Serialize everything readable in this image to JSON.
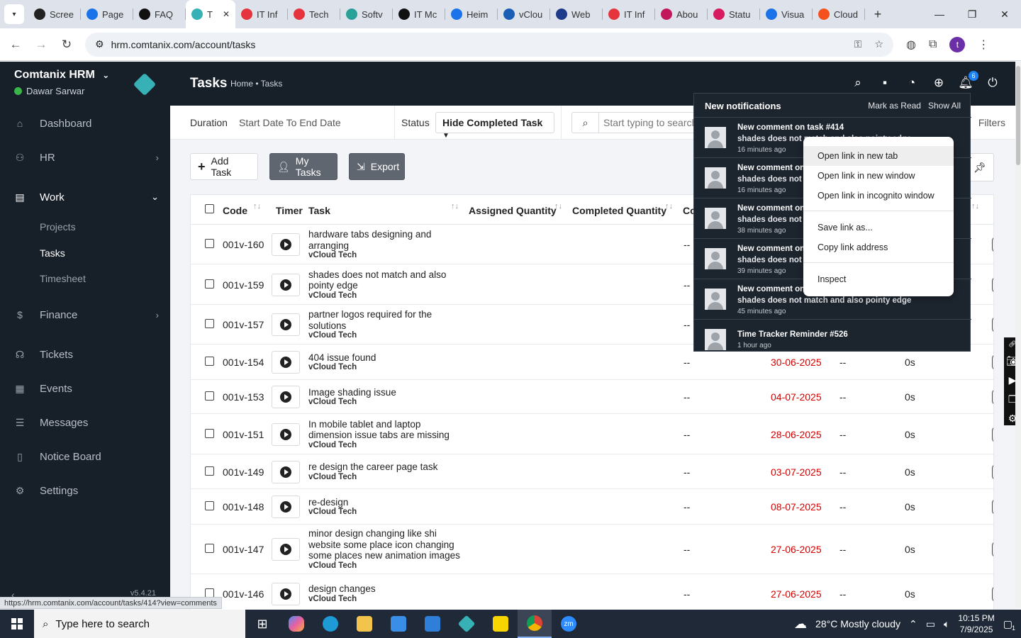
{
  "browser": {
    "tabs": [
      {
        "label": "Scree",
        "color": "#222222"
      },
      {
        "label": "Page",
        "color": "#1a73e8"
      },
      {
        "label": "FAQ",
        "color": "#111111"
      },
      {
        "label": "T",
        "color": "#38b1b6"
      },
      {
        "label": "IT Inf",
        "color": "#e5343e"
      },
      {
        "label": "Tech",
        "color": "#e5343e"
      },
      {
        "label": "Softv",
        "color": "#2aa198"
      },
      {
        "label": "IT Mc",
        "color": "#111111"
      },
      {
        "label": "Heim",
        "color": "#1a73e8"
      },
      {
        "label": "vClou",
        "color": "#1a5fb4"
      },
      {
        "label": "Web",
        "color": "#1e3a8a"
      },
      {
        "label": "IT Inf",
        "color": "#e5343e"
      },
      {
        "label": "Abou",
        "color": "#c2185b"
      },
      {
        "label": "Statu",
        "color": "#d81b60"
      },
      {
        "label": "Visua",
        "color": "#1a73e8"
      },
      {
        "label": "Cloud",
        "color": "#f4511e"
      }
    ],
    "url": "hrm.comtanix.com/account/tasks",
    "profile_initial": "t",
    "status_url": "https://hrm.comtanix.com/account/tasks/414?view=comments"
  },
  "sidebar": {
    "brand": "Comtanix HRM",
    "user": "Dawar Sarwar",
    "version": "v5.4.21",
    "items": [
      {
        "label": "Dashboard",
        "icon": "home-icon"
      },
      {
        "label": "HR",
        "icon": "users-icon"
      },
      {
        "label": "Work",
        "icon": "briefcase-icon"
      },
      {
        "label": "Finance",
        "icon": "dollar-icon"
      },
      {
        "label": "Tickets",
        "icon": "headset-icon"
      },
      {
        "label": "Events",
        "icon": "calendar-icon"
      },
      {
        "label": "Messages",
        "icon": "message-icon"
      },
      {
        "label": "Notice Board",
        "icon": "clipboard-icon"
      },
      {
        "label": "Settings",
        "icon": "gear-icon"
      }
    ],
    "work_sub": [
      "Projects",
      "Tasks",
      "Timesheet"
    ]
  },
  "header": {
    "title": "Tasks",
    "breadcrumb": "Home • Tasks",
    "notification_count": "6"
  },
  "filters": {
    "duration_label": "Duration",
    "duration_value": "Start Date To End Date",
    "status_label": "Status",
    "status_value": "Hide Completed Task",
    "search_placeholder": "Start typing to search",
    "filters_label": "Filters"
  },
  "actions": {
    "add_task": "Add Task",
    "my_tasks": "My Tasks",
    "export": "Export"
  },
  "table": {
    "columns": [
      "Code",
      "Timer",
      "Task",
      "Assigned Quantity",
      "Completed Quantity",
      "Co"
    ],
    "rows": [
      {
        "code": "001v-160",
        "title": "hardware tabs designing and arranging",
        "client": "vCloud Tech",
        "col1": "--",
        "due": "",
        "col3": "",
        "time": ""
      },
      {
        "code": "001v-159",
        "title": "shades does not match and also pointy edge",
        "client": "vCloud Tech",
        "col1": "--",
        "due": "",
        "col3": "",
        "time": ""
      },
      {
        "code": "001v-157",
        "title": "partner logos required for the solutions",
        "client": "vCloud Tech",
        "col1": "--",
        "due": "",
        "col3": "",
        "time": ""
      },
      {
        "code": "001v-154",
        "title": "404 issue found",
        "client": "vCloud Tech",
        "col1": "--",
        "due": "30-06-2025",
        "col3": "--",
        "time": "0s"
      },
      {
        "code": "001v-153",
        "title": "Image shading issue",
        "client": "vCloud Tech",
        "col1": "--",
        "due": "04-07-2025",
        "col3": "--",
        "time": "0s"
      },
      {
        "code": "001v-151",
        "title": "In mobile tablet and laptop dimension issue tabs are missing",
        "client": "vCloud Tech",
        "col1": "--",
        "due": "28-06-2025",
        "col3": "--",
        "time": "0s"
      },
      {
        "code": "001v-149",
        "title": "re design the career page task",
        "client": "vCloud Tech",
        "col1": "--",
        "due": "03-07-2025",
        "col3": "--",
        "time": "0s"
      },
      {
        "code": "001v-148",
        "title": "re-design",
        "client": "vCloud Tech",
        "col1": "--",
        "due": "08-07-2025",
        "col3": "--",
        "time": "0s"
      },
      {
        "code": "001v-147",
        "title": "minor design changing like shi website some place icon changing some places new animation images",
        "client": "vCloud Tech",
        "col1": "--",
        "due": "27-06-2025",
        "col3": "--",
        "time": "0s"
      },
      {
        "code": "001v-146",
        "title": "design changes",
        "client": "vCloud Tech",
        "col1": "--",
        "due": "27-06-2025",
        "col3": "--",
        "time": "0s"
      }
    ]
  },
  "notifications": {
    "title": "New notifications",
    "mark_read": "Mark as Read",
    "show_all": "Show All",
    "items": [
      {
        "title": "New comment on task #414",
        "body": "shades does not match and also pointy edge",
        "time": "16 minutes ago"
      },
      {
        "title": "New comment on",
        "body": "shades does not m",
        "time": "16 minutes ago"
      },
      {
        "title": "New comment on",
        "body": "shades does not m",
        "time": "38 minutes ago"
      },
      {
        "title": "New comment on",
        "body": "shades does not m",
        "time": "39 minutes ago"
      },
      {
        "title": "New comment on",
        "body": "shades does not match and also pointy edge",
        "time": "45 minutes ago"
      },
      {
        "title": "Time Tracker Reminder #526",
        "body": "",
        "time": "1 hour ago"
      }
    ]
  },
  "context_menu": {
    "items": [
      "Open link in new tab",
      "Open link in new window",
      "Open link in incognito window",
      "Save link as...",
      "Copy link address",
      "Inspect"
    ]
  },
  "taskbar": {
    "search_placeholder": "Type here to search",
    "weather": "28°C  Mostly cloudy",
    "time": "10:15 PM",
    "date": "7/9/2025",
    "notif_count": "1"
  }
}
